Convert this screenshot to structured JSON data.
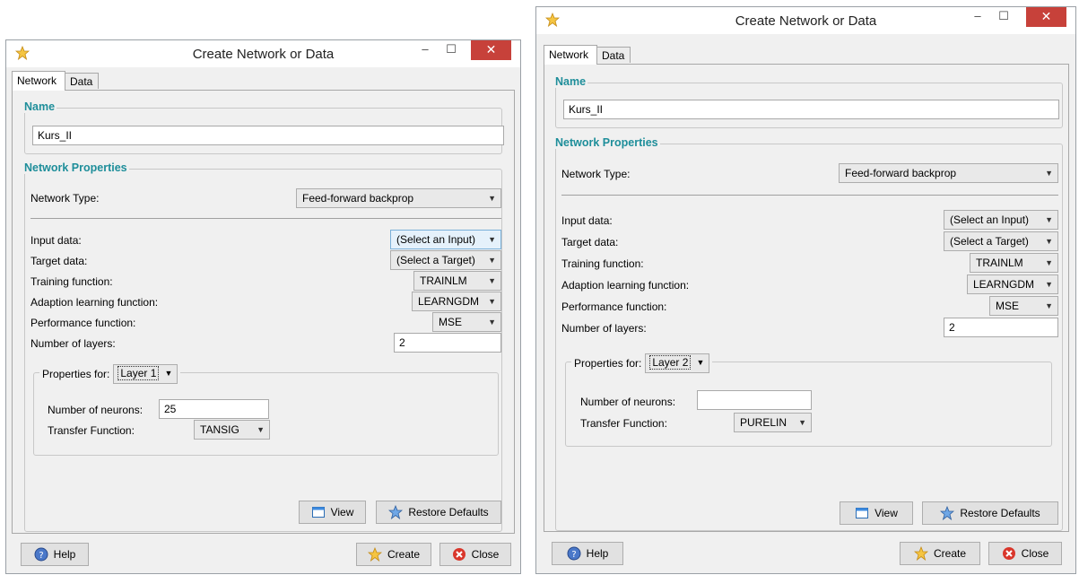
{
  "windows": [
    {
      "title": "Create Network or Data",
      "tabs": [
        "Network",
        "Data"
      ],
      "name_group": {
        "legend": "Name",
        "value": "Kurs_II"
      },
      "props_group": {
        "legend": "Network Properties",
        "network_type_label": "Network Type:",
        "network_type_value": "Feed-forward backprop",
        "input_data_label": "Input data:",
        "input_data_value": "(Select an Input)",
        "target_data_label": "Target data:",
        "target_data_value": "(Select a Target)",
        "training_label": "Training function:",
        "training_value": "TRAINLM",
        "adaption_label": "Adaption learning function:",
        "adaption_value": "LEARNGDM",
        "performance_label": "Performance function:",
        "performance_value": "MSE",
        "layers_label": "Number of layers:",
        "layers_value": "2"
      },
      "layer_group": {
        "legend_label": "Properties for:",
        "layer_value": "Layer 1",
        "neurons_label": "Number of neurons:",
        "neurons_value": "25",
        "transfer_label": "Transfer Function:",
        "transfer_value": "TANSIG"
      },
      "buttons": {
        "view": "View",
        "restore": "Restore Defaults",
        "help": "Help",
        "create": "Create",
        "close": "Close"
      }
    },
    {
      "title": "Create Network or Data",
      "tabs": [
        "Network",
        "Data"
      ],
      "name_group": {
        "legend": "Name",
        "value": "Kurs_II"
      },
      "props_group": {
        "legend": "Network Properties",
        "network_type_label": "Network Type:",
        "network_type_value": "Feed-forward backprop",
        "input_data_label": "Input data:",
        "input_data_value": "(Select an Input)",
        "target_data_label": "Target data:",
        "target_data_value": "(Select a Target)",
        "training_label": "Training function:",
        "training_value": "TRAINLM",
        "adaption_label": "Adaption learning function:",
        "adaption_value": "LEARNGDM",
        "performance_label": "Performance function:",
        "performance_value": "MSE",
        "layers_label": "Number of layers:",
        "layers_value": "2"
      },
      "layer_group": {
        "legend_label": "Properties for:",
        "layer_value": "Layer 2",
        "neurons_label": "Number of neurons:",
        "neurons_value": "",
        "transfer_label": "Transfer Function:",
        "transfer_value": "PURELIN"
      },
      "buttons": {
        "view": "View",
        "restore": "Restore Defaults",
        "help": "Help",
        "create": "Create",
        "close": "Close"
      }
    }
  ],
  "icons": {
    "app": "star-icon",
    "view": "window-icon",
    "restore": "star-icon",
    "help": "help-icon",
    "create": "star-icon",
    "close": "close-icon"
  },
  "colors": {
    "legend": "#1e8e9a",
    "close_button": "#c7413a",
    "select_focus": "#e5f1fb"
  }
}
